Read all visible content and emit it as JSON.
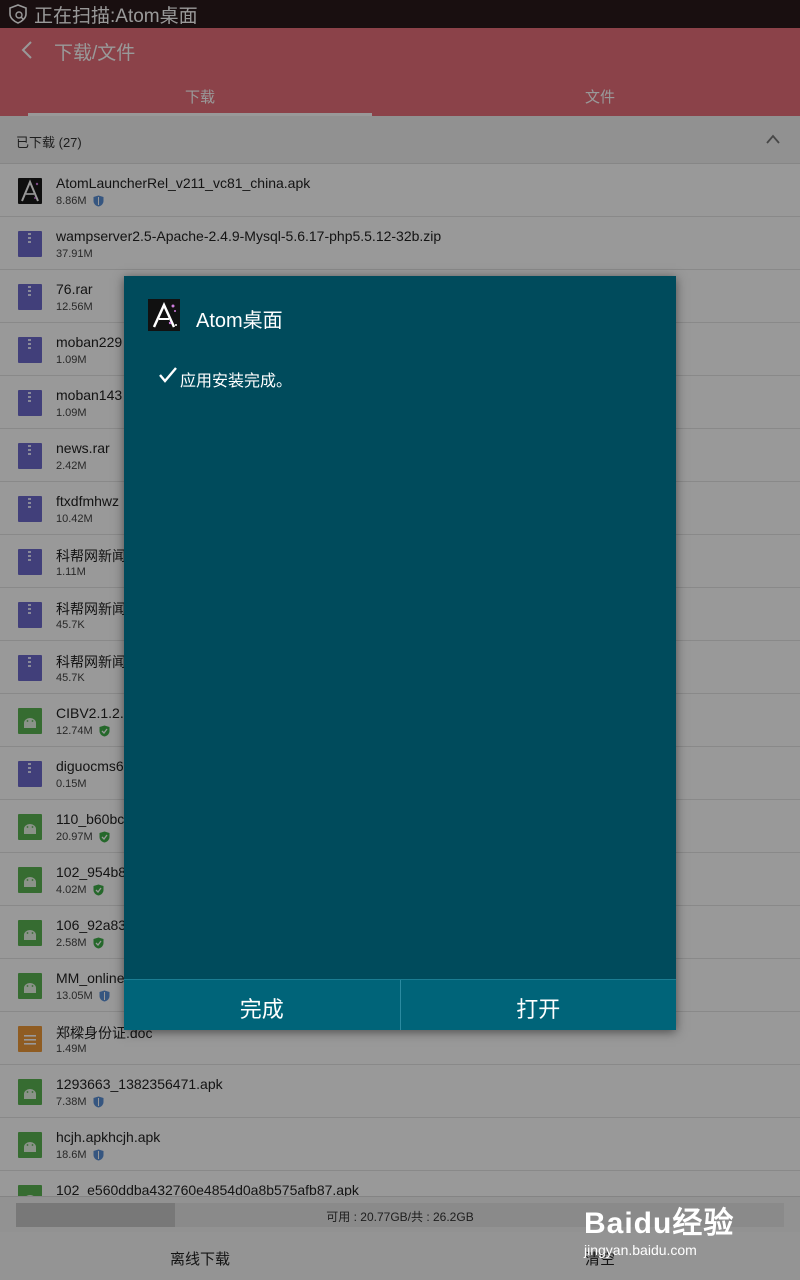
{
  "status_bar": {
    "text": "正在扫描:Atom桌面"
  },
  "header": {
    "title": "下载/文件",
    "tabs": [
      {
        "label": "下载"
      },
      {
        "label": "文件"
      }
    ]
  },
  "section": {
    "title": "已下载 (27)"
  },
  "files": [
    {
      "name": "AtomLauncherRel_v211_vc81_china.apk",
      "size": "8.86M",
      "icon": "atom-app-icon",
      "badge": "shield"
    },
    {
      "name": "wampserver2.5-Apache-2.4.9-Mysql-5.6.17-php5.5.12-32b.zip",
      "size": "37.91M",
      "icon": "zip-file-icon"
    },
    {
      "name": "76.rar",
      "size": "12.56M",
      "icon": "zip-file-icon"
    },
    {
      "name": "moban229",
      "size": "1.09M",
      "icon": "zip-file-icon"
    },
    {
      "name": "moban143",
      "size": "1.09M",
      "icon": "zip-file-icon"
    },
    {
      "name": "news.rar",
      "size": "2.42M",
      "icon": "zip-file-icon"
    },
    {
      "name": "ftxdfmhwz",
      "size": "10.42M",
      "icon": "zip-file-icon"
    },
    {
      "name": "科帮网新闻",
      "size": "1.11M",
      "icon": "zip-file-icon"
    },
    {
      "name": "科帮网新闻",
      "size": "45.7K",
      "icon": "zip-file-icon"
    },
    {
      "name": "科帮网新闻",
      "size": "45.7K",
      "icon": "zip-file-icon"
    },
    {
      "name": "CIBV2.1.2.a",
      "size": "12.74M",
      "icon": "android-file-icon",
      "badge": "check"
    },
    {
      "name": "diguocms6",
      "size": "0.15M",
      "icon": "zip-file-icon"
    },
    {
      "name": "110_b60bc",
      "size": "20.97M",
      "icon": "android-file-icon",
      "badge": "check"
    },
    {
      "name": "102_954b8",
      "size": "4.02M",
      "icon": "android-file-icon",
      "badge": "check"
    },
    {
      "name": "106_92a83",
      "size": "2.58M",
      "icon": "android-file-icon",
      "badge": "check"
    },
    {
      "name": "MM_online",
      "size": "13.05M",
      "icon": "android-file-icon",
      "badge": "shield"
    },
    {
      "name": "郑樑身份证.doc",
      "size": "1.49M",
      "icon": "doc-file-icon"
    },
    {
      "name": "1293663_1382356471.apk",
      "size": "7.38M",
      "icon": "android-file-icon",
      "badge": "shield"
    },
    {
      "name": "hcjh.apkhcjh.apk",
      "size": "18.6M",
      "icon": "android-file-icon",
      "badge": "shield"
    },
    {
      "name": "102_e560ddba432760e4854d0a8b575afb87.apk",
      "size": "",
      "icon": "android-file-icon"
    }
  ],
  "storage": {
    "text": "可用 : 20.77GB/共 : 26.2GB",
    "used_fraction": 0.207
  },
  "bottom_bar": {
    "left_label": "离线下载",
    "right_label": "清空"
  },
  "dialog": {
    "app_name": "Atom桌面",
    "message": "应用安装完成。",
    "done_label": "完成",
    "open_label": "打开"
  },
  "watermark": {
    "logo": "Baidu经验",
    "url": "jingyan.baidu.com"
  },
  "colors": {
    "header": "#e86e7a",
    "dialog_bg": "#004b5c",
    "dialog_buttons": "#006479",
    "zip": "#6d6acb",
    "apk": "#5bb553",
    "doc": "#ef9a3a"
  }
}
